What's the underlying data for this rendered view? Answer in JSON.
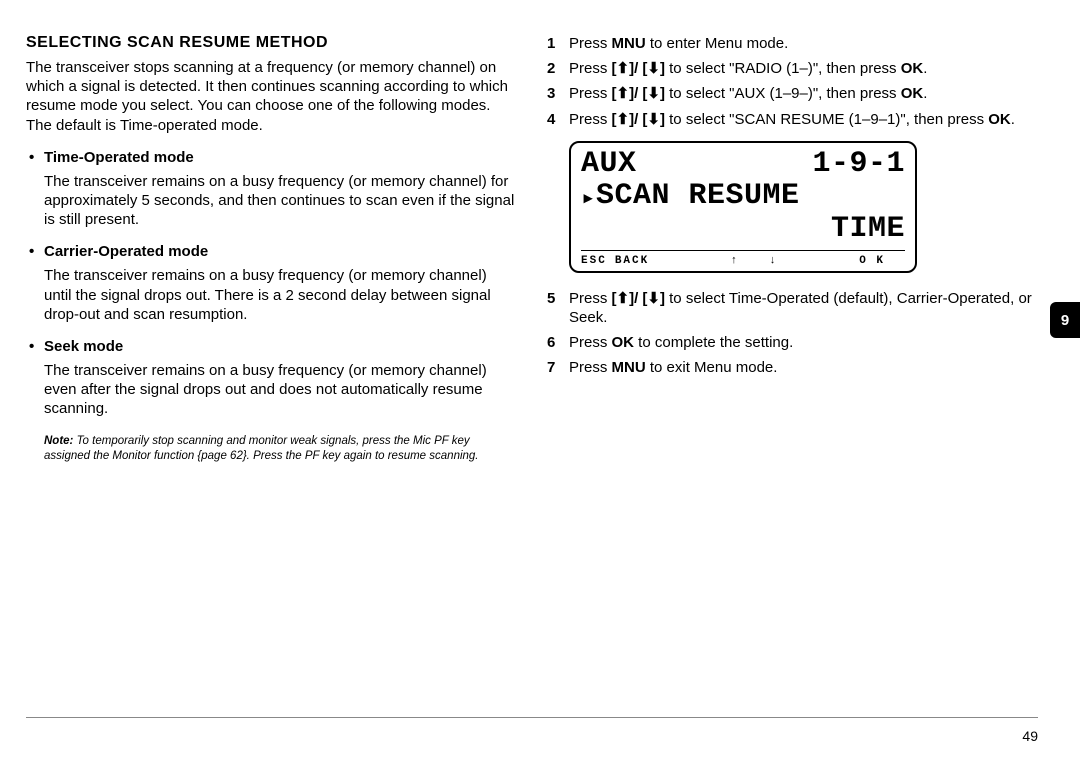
{
  "left": {
    "heading": "SELECTING SCAN RESUME METHOD",
    "intro": "The transceiver stops scanning at a frequency (or memory channel) on which a signal is detected.  It then continues scanning according to which resume mode you select.  You can choose one of the following modes.  The default is Time-operated mode.",
    "modes": [
      {
        "title": "Time-Operated mode",
        "body": "The transceiver remains on a busy frequency (or memory channel) for approximately 5 seconds, and then continues to scan even if the signal is still present."
      },
      {
        "title": "Carrier-Operated mode",
        "body": "The transceiver remains on a busy frequency (or memory channel) until the signal drops out.  There is a 2 second delay between signal drop-out and scan resumption."
      },
      {
        "title": "Seek mode",
        "body": "The transceiver remains on a busy frequency (or memory channel) even after the signal drops out and does not automatically resume scanning."
      }
    ],
    "note_label": "Note:",
    "note_body": "  To temporarily stop scanning and monitor weak signals, press the Mic PF key assigned the Monitor function {page 62}.  Press the PF key again to resume scanning."
  },
  "right": {
    "steps": [
      {
        "num": "1",
        "pre": "Press ",
        "btn": "MNU",
        "post": " to enter Menu mode."
      },
      {
        "num": "2",
        "pre": "Press ",
        "btn": "[⬆]/ [⬇]",
        "post": " to select \"RADIO (1–)\", then press ",
        "btn2": "OK",
        "post2": "."
      },
      {
        "num": "3",
        "pre": "Press ",
        "btn": "[⬆]/ [⬇]",
        "post": " to select \"AUX (1–9–)\", then press ",
        "btn2": "OK",
        "post2": "."
      },
      {
        "num": "4",
        "pre": "Press ",
        "btn": "[⬆]/ [⬇]",
        "post": " to select \"SCAN RESUME  (1–9–1)\", then press ",
        "btn2": "OK",
        "post2": "."
      },
      {
        "num": "5",
        "pre": "Press ",
        "btn": "[⬆]/ [⬇]",
        "post": " to select Time-Operated (default), Carrier-Operated, or Seek."
      },
      {
        "num": "6",
        "pre": "Press ",
        "btn": "OK",
        "post": " to complete the setting."
      },
      {
        "num": "7",
        "pre": "Press ",
        "btn": "MNU",
        "post": " to exit Menu mode."
      }
    ],
    "lcd": {
      "aux": "AUX",
      "code": "1-9-1",
      "line2_prefix": "▸",
      "line2": "SCAN RESUME",
      "line3": "TIME",
      "footer": {
        "esc": "ESC",
        "back": "BACK",
        "up": "↑",
        "down": "↓",
        "ok": "O K"
      }
    }
  },
  "section_tab": "9",
  "page_number": "49"
}
